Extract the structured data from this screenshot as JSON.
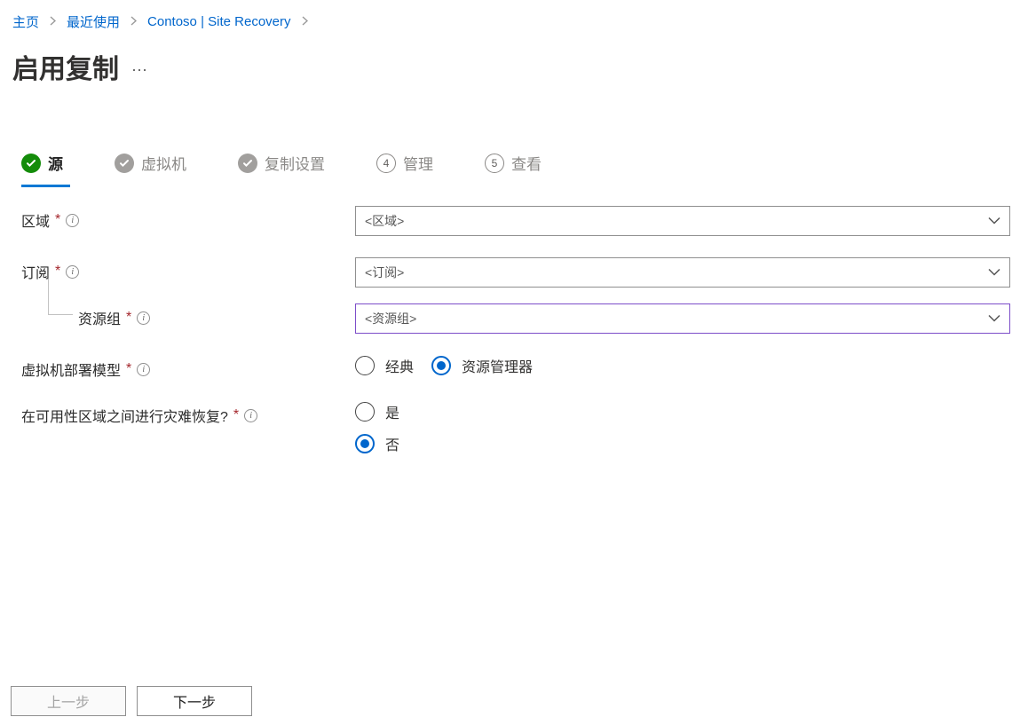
{
  "breadcrumb": {
    "home": "主页",
    "recent": "最近使用",
    "contoso": "Contoso  | Site Recovery"
  },
  "page": {
    "title": "启用复制",
    "more": "···"
  },
  "wizard": {
    "step1": {
      "label": "源"
    },
    "step2": {
      "label": "虚拟机"
    },
    "step3": {
      "label": "复制设置"
    },
    "step4": {
      "num": "4",
      "label": "管理"
    },
    "step5": {
      "num": "5",
      "label": "查看"
    }
  },
  "form": {
    "region": {
      "label": "区域",
      "placeholder": "<区域>"
    },
    "subscription": {
      "label": "订阅",
      "placeholder": "<订阅>"
    },
    "resource_group": {
      "label": "资源组",
      "placeholder": "<资源组>"
    },
    "deploy_model": {
      "label": "虚拟机部署模型",
      "opt_classic": "经典",
      "opt_rm": "资源管理器"
    },
    "dr_zones": {
      "label": "在可用性区域之间进行灾难恢复?",
      "opt_yes": "是",
      "opt_no": "否"
    }
  },
  "footer": {
    "prev": "上一步",
    "next": "下一步"
  }
}
